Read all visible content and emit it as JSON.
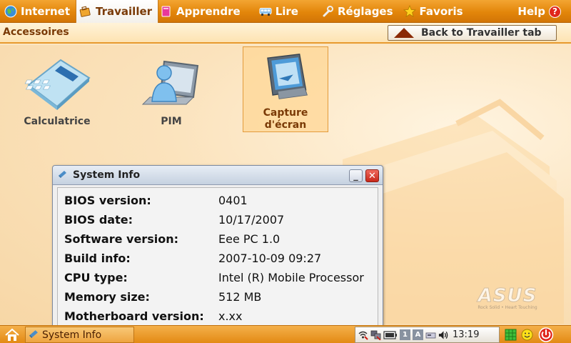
{
  "tabs": [
    {
      "label": "Internet",
      "icon": "globe-icon",
      "active": false
    },
    {
      "label": "Travailler",
      "icon": "briefcase-icon",
      "active": true
    },
    {
      "label": "Apprendre",
      "icon": "book-icon",
      "active": false
    },
    {
      "label": "Lire",
      "icon": "bus-icon",
      "active": false
    },
    {
      "label": "Réglages",
      "icon": "wrench-icon",
      "active": false
    },
    {
      "label": "Favoris",
      "icon": "star-icon",
      "active": false
    }
  ],
  "help_label": "Help",
  "subheader": {
    "title": "Accessoires",
    "back_label": "Back to Travailler tab"
  },
  "apps": [
    {
      "label": "Calculatrice",
      "icon": "calculator-icon",
      "selected": false
    },
    {
      "label": "PIM",
      "icon": "pim-icon",
      "selected": false
    },
    {
      "label": "Capture\nd'écran",
      "line1": "Capture",
      "line2": "d'écran",
      "icon": "screen-capture-icon",
      "selected": true
    }
  ],
  "logo": {
    "brand": "ASUS",
    "slogan": "Rock Solid • Heart Touching"
  },
  "dialog": {
    "title": "System Info",
    "rows": [
      {
        "label": "BIOS version:",
        "value": "0401"
      },
      {
        "label": "BIOS date:",
        "value": "10/17/2007"
      },
      {
        "label": "Software version:",
        "value": "Eee PC 1.0"
      },
      {
        "label": "Build info:",
        "value": "2007-10-09 09:27"
      },
      {
        "label": "CPU type:",
        "value": "Intel (R) Mobile Processor"
      },
      {
        "label": "Memory size:",
        "value": "512 MB"
      },
      {
        "label": "Motherboard version:",
        "value": "x.xx"
      }
    ]
  },
  "taskbar": {
    "task_label": "System Info",
    "tray_letter_1": "1",
    "tray_letter_a": "A",
    "clock": "13:19"
  },
  "colors": {
    "accent": "#e3860a",
    "active_tab_text": "#7a3a06",
    "close": "#c8281a"
  }
}
